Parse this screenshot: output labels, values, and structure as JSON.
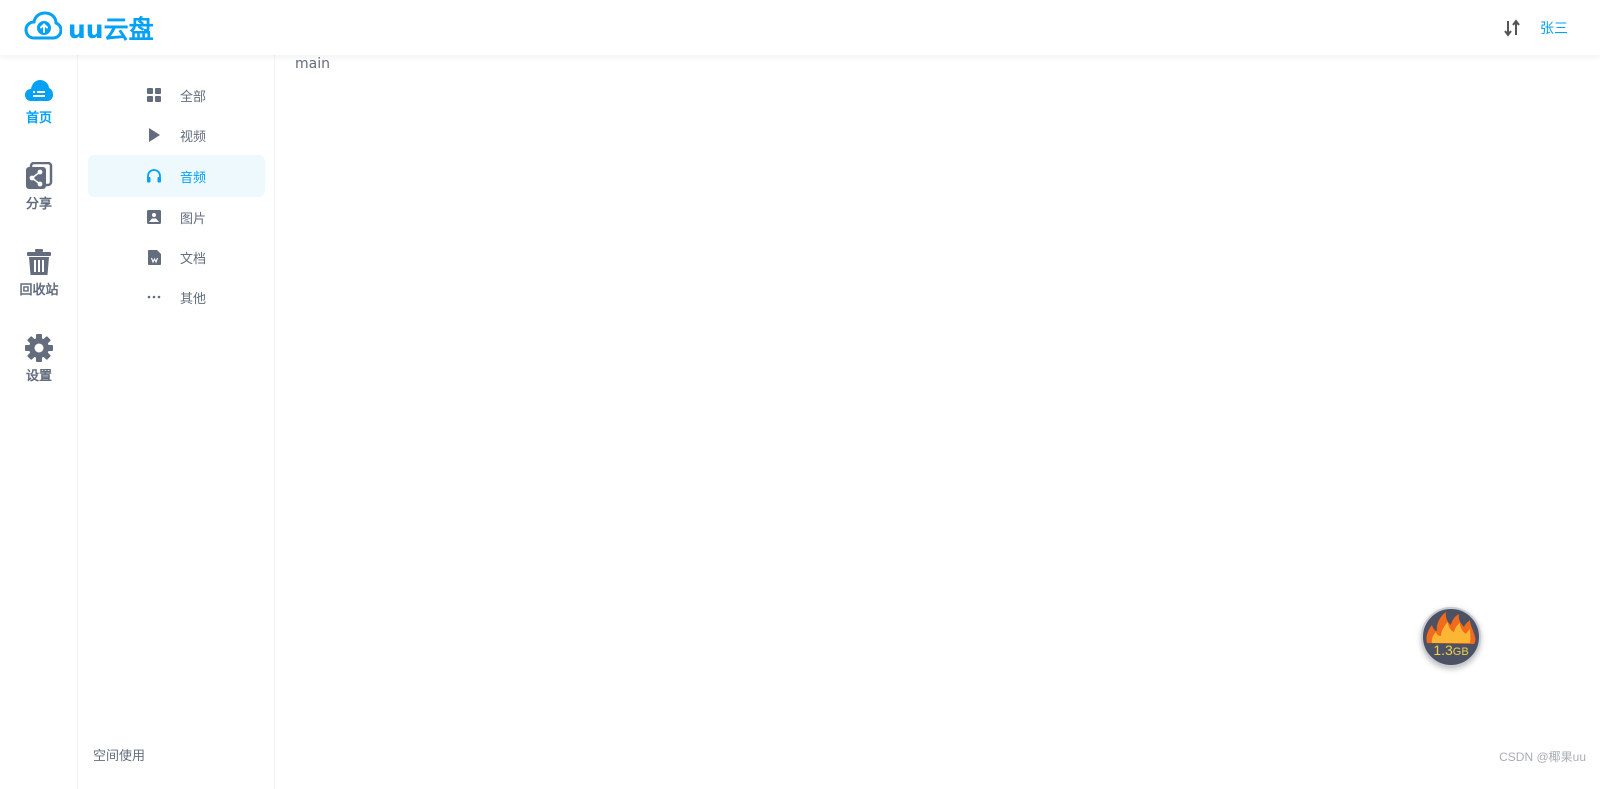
{
  "header": {
    "logo_text": "uu云盘",
    "user_name": "张三"
  },
  "rail": {
    "items": [
      {
        "label": "首页",
        "icon": "cloud-icon",
        "active": true
      },
      {
        "label": "分享",
        "icon": "share-icon",
        "active": false
      },
      {
        "label": "回收站",
        "icon": "trash-icon",
        "active": false
      },
      {
        "label": "设置",
        "icon": "gear-icon",
        "active": false
      }
    ]
  },
  "subnav": {
    "items": [
      {
        "label": "全部",
        "icon": "grid-icon",
        "active": false
      },
      {
        "label": "视频",
        "icon": "play-icon",
        "active": false
      },
      {
        "label": "音频",
        "icon": "headphones-icon",
        "active": true
      },
      {
        "label": "图片",
        "icon": "image-icon",
        "active": false
      },
      {
        "label": "文档",
        "icon": "document-icon",
        "active": false
      },
      {
        "label": "其他",
        "icon": "more-icon",
        "active": false
      }
    ],
    "space_usage_label": "空间使用"
  },
  "main": {
    "content_text": "main"
  },
  "float_widget": {
    "value": "1.3",
    "unit": "GB"
  },
  "watermark": "CSDN @椰果uu",
  "colors": {
    "accent": "#05a1f5",
    "text": "#636d7e",
    "active_bg": "#eef9fe"
  }
}
